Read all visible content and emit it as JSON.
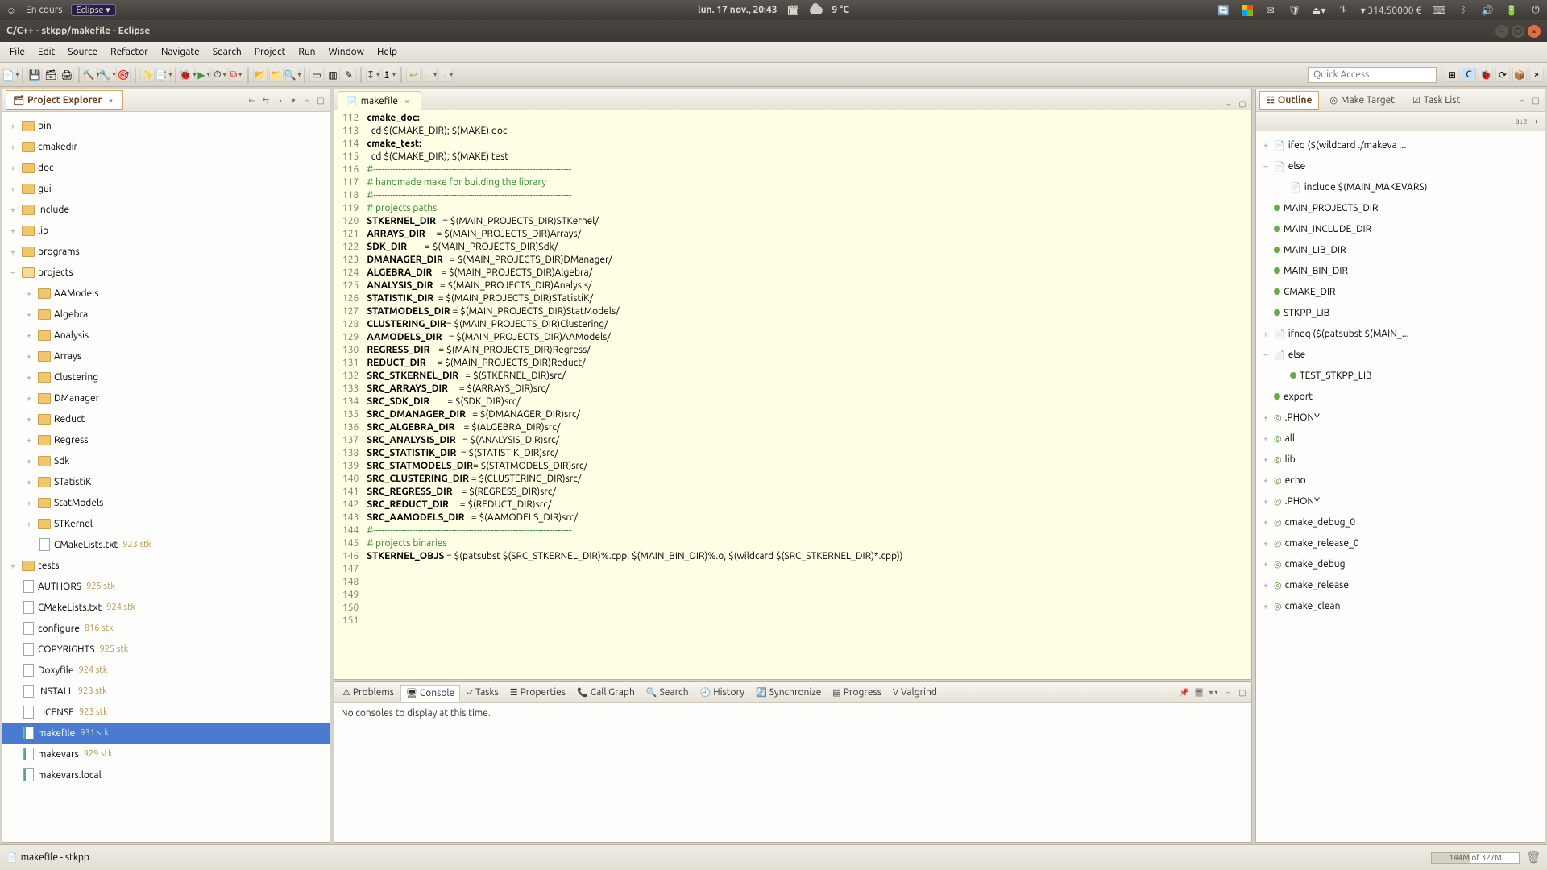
{
  "panel": {
    "activities": "En cours",
    "app": "Eclipse ▾",
    "datetime": "lun. 17 nov., 20:43",
    "temp": "9 °C",
    "balance": "314.50000 €"
  },
  "window": {
    "title": "C/C++ - stkpp/makefile - Eclipse"
  },
  "menu": [
    "File",
    "Edit",
    "Source",
    "Refactor",
    "Navigate",
    "Search",
    "Project",
    "Run",
    "Window",
    "Help"
  ],
  "quick_access_placeholder": "Quick Access",
  "explorer": {
    "title": "Project Explorer",
    "tree": [
      {
        "d": 1,
        "t": "folder",
        "exp": "+",
        "label": "bin"
      },
      {
        "d": 1,
        "t": "folder",
        "exp": "+",
        "label": "cmakedir"
      },
      {
        "d": 1,
        "t": "folder",
        "exp": "+",
        "label": "doc"
      },
      {
        "d": 1,
        "t": "folder",
        "exp": "+",
        "label": "gui"
      },
      {
        "d": 1,
        "t": "folder",
        "exp": "+",
        "label": "include"
      },
      {
        "d": 1,
        "t": "folder",
        "exp": "+",
        "label": "lib"
      },
      {
        "d": 1,
        "t": "folder",
        "exp": "+",
        "label": "programs"
      },
      {
        "d": 1,
        "t": "folder-open",
        "exp": "–",
        "label": "projects"
      },
      {
        "d": 2,
        "t": "folder",
        "exp": "+",
        "label": "AAModels"
      },
      {
        "d": 2,
        "t": "folder",
        "exp": "+",
        "label": "Algebra"
      },
      {
        "d": 2,
        "t": "folder",
        "exp": "+",
        "label": "Analysis"
      },
      {
        "d": 2,
        "t": "folder",
        "exp": "+",
        "label": "Arrays"
      },
      {
        "d": 2,
        "t": "folder",
        "exp": "+",
        "label": "Clustering"
      },
      {
        "d": 2,
        "t": "folder",
        "exp": "+",
        "label": "DManager"
      },
      {
        "d": 2,
        "t": "folder",
        "exp": "+",
        "label": "Reduct"
      },
      {
        "d": 2,
        "t": "folder",
        "exp": "+",
        "label": "Regress"
      },
      {
        "d": 2,
        "t": "folder",
        "exp": "+",
        "label": "Sdk"
      },
      {
        "d": 2,
        "t": "folder",
        "exp": "+",
        "label": "STatistiK"
      },
      {
        "d": 2,
        "t": "folder",
        "exp": "+",
        "label": "StatModels"
      },
      {
        "d": 2,
        "t": "folder",
        "exp": "+",
        "label": "STKernel"
      },
      {
        "d": 2,
        "t": "file",
        "exp": "",
        "label": "CMakeLists.txt",
        "rev": "923  stk"
      },
      {
        "d": 1,
        "t": "folder",
        "exp": "+",
        "label": "tests"
      },
      {
        "d": 1,
        "t": "file",
        "exp": "",
        "label": "AUTHORS",
        "rev": "925  stk"
      },
      {
        "d": 1,
        "t": "file",
        "exp": "",
        "label": "CMakeLists.txt",
        "rev": "924  stk"
      },
      {
        "d": 1,
        "t": "file",
        "exp": "",
        "label": "configure",
        "rev": "816  stk"
      },
      {
        "d": 1,
        "t": "file",
        "exp": "",
        "label": "COPYRIGHTS",
        "rev": "925  stk"
      },
      {
        "d": 1,
        "t": "file",
        "exp": "",
        "label": "Doxyfile",
        "rev": "924  stk"
      },
      {
        "d": 1,
        "t": "file",
        "exp": "",
        "label": "INSTALL",
        "rev": "923  stk"
      },
      {
        "d": 1,
        "t": "file",
        "exp": "",
        "label": "LICENSE",
        "rev": "923  stk"
      },
      {
        "d": 1,
        "t": "mk",
        "exp": "",
        "label": "makefile",
        "rev": "931  stk",
        "selected": true
      },
      {
        "d": 1,
        "t": "mk",
        "exp": "",
        "label": "makevars",
        "rev": "929  stk"
      },
      {
        "d": 1,
        "t": "mk",
        "exp": "",
        "label": "makevars.local"
      }
    ]
  },
  "editor": {
    "tab": "makefile",
    "first_line": 112,
    "lines": [
      {
        "cls": "",
        "txt": ""
      },
      {
        "cls": "",
        "txt": "cmake_doc:",
        "b": [
          0,
          10
        ]
      },
      {
        "cls": "",
        "txt": "  cd $(CMAKE_DIR); $(MAKE) doc"
      },
      {
        "cls": "",
        "txt": ""
      },
      {
        "cls": "",
        "txt": "cmake_test:",
        "b": [
          0,
          11
        ]
      },
      {
        "cls": "",
        "txt": "  cd $(CMAKE_DIR); $(MAKE) test"
      },
      {
        "cls": "",
        "txt": ""
      },
      {
        "cls": "comment",
        "txt": "#-----------------------------------------------------------------------"
      },
      {
        "cls": "comment",
        "txt": "# handmade make for building the library"
      },
      {
        "cls": "comment",
        "txt": "#-----------------------------------------------------------------------"
      },
      {
        "cls": "comment",
        "txt": "# projects paths"
      },
      {
        "cls": "",
        "txt": "STKERNEL_DIR   = $(MAIN_PROJECTS_DIR)STKernel/",
        "b": [
          0,
          12
        ]
      },
      {
        "cls": "",
        "txt": "ARRAYS_DIR     = $(MAIN_PROJECTS_DIR)Arrays/",
        "b": [
          0,
          10
        ]
      },
      {
        "cls": "",
        "txt": "SDK_DIR        = $(MAIN_PROJECTS_DIR)Sdk/",
        "b": [
          0,
          7
        ]
      },
      {
        "cls": "",
        "txt": "DMANAGER_DIR   = $(MAIN_PROJECTS_DIR)DManager/",
        "b": [
          0,
          12
        ]
      },
      {
        "cls": "",
        "txt": "ALGEBRA_DIR    = $(MAIN_PROJECTS_DIR)Algebra/",
        "b": [
          0,
          11
        ]
      },
      {
        "cls": "",
        "txt": "ANALYSIS_DIR   = $(MAIN_PROJECTS_DIR)Analysis/",
        "b": [
          0,
          12
        ]
      },
      {
        "cls": "",
        "txt": "STATISTIK_DIR  = $(MAIN_PROJECTS_DIR)STatistiK/",
        "b": [
          0,
          13
        ]
      },
      {
        "cls": "",
        "txt": "STATMODELS_DIR = $(MAIN_PROJECTS_DIR)StatModels/",
        "b": [
          0,
          14
        ]
      },
      {
        "cls": "",
        "txt": "CLUSTERING_DIR= $(MAIN_PROJECTS_DIR)Clustering/",
        "b": [
          0,
          14
        ]
      },
      {
        "cls": "",
        "txt": "AAMODELS_DIR   = $(MAIN_PROJECTS_DIR)AAModels/",
        "b": [
          0,
          12
        ]
      },
      {
        "cls": "",
        "txt": "REGRESS_DIR    = $(MAIN_PROJECTS_DIR)Regress/",
        "b": [
          0,
          11
        ]
      },
      {
        "cls": "",
        "txt": "REDUCT_DIR     = $(MAIN_PROJECTS_DIR)Reduct/",
        "b": [
          0,
          10
        ]
      },
      {
        "cls": "",
        "txt": ""
      },
      {
        "cls": "",
        "txt": "SRC_STKERNEL_DIR   = $(STKERNEL_DIR)src/",
        "b": [
          0,
          16
        ]
      },
      {
        "cls": "",
        "txt": "SRC_ARRAYS_DIR     = $(ARRAYS_DIR)src/",
        "b": [
          0,
          14
        ]
      },
      {
        "cls": "",
        "txt": "SRC_SDK_DIR        = $(SDK_DIR)src/",
        "b": [
          0,
          11
        ]
      },
      {
        "cls": "",
        "txt": "SRC_DMANAGER_DIR   = $(DMANAGER_DIR)src/",
        "b": [
          0,
          16
        ]
      },
      {
        "cls": "",
        "txt": "SRC_ALGEBRA_DIR    = $(ALGEBRA_DIR)src/",
        "b": [
          0,
          15
        ]
      },
      {
        "cls": "",
        "txt": "SRC_ANALYSIS_DIR   = $(ANALYSIS_DIR)src/",
        "b": [
          0,
          16
        ]
      },
      {
        "cls": "",
        "txt": "SRC_STATISTIK_DIR  = $(STATISTIK_DIR)src/",
        "b": [
          0,
          17
        ]
      },
      {
        "cls": "",
        "txt": "SRC_STATMODELS_DIR= $(STATMODELS_DIR)src/",
        "b": [
          0,
          18
        ]
      },
      {
        "cls": "",
        "txt": "SRC_CLUSTERING_DIR = $(CLUSTERING_DIR)src/",
        "b": [
          0,
          18
        ]
      },
      {
        "cls": "",
        "txt": "SRC_REGRESS_DIR    = $(REGRESS_DIR)src/",
        "b": [
          0,
          15
        ]
      },
      {
        "cls": "",
        "txt": "SRC_REDUCT_DIR     = $(REDUCT_DIR)src/",
        "b": [
          0,
          14
        ]
      },
      {
        "cls": "",
        "txt": "SRC_AAMODELS_DIR   = $(AAMODELS_DIR)src/",
        "b": [
          0,
          16
        ]
      },
      {
        "cls": "",
        "txt": ""
      },
      {
        "cls": "comment",
        "txt": "#-----------------------------------------------------------------------"
      },
      {
        "cls": "comment",
        "txt": "# projects binaries"
      },
      {
        "cls": "",
        "txt": "STKERNEL_OBJS = $(patsubst $(SRC_STKERNEL_DIR)%.cpp, $(MAIN_BIN_DIR)%.o, $(wildcard $(SRC_STKERNEL_DIR)*.cpp))",
        "b": [
          0,
          13
        ]
      }
    ]
  },
  "bottom": {
    "tabs": [
      "Problems",
      "Console",
      "Tasks",
      "Properties",
      "Call Graph",
      "Search",
      "History",
      "Synchronize",
      "Progress",
      "Valgrind"
    ],
    "active": 1,
    "console_msg": "No consoles to display at this time."
  },
  "outline": {
    "tabs": [
      "Outline",
      "Make Target",
      "Task List"
    ],
    "items": [
      {
        "tw": "+",
        "sub": false,
        "k": "inc",
        "label": "ifeq ($(wildcard ./makeva ..."
      },
      {
        "tw": "–",
        "sub": false,
        "k": "inc",
        "label": "else"
      },
      {
        "tw": "",
        "sub": true,
        "k": "inc",
        "label": "include $(MAIN_MAKEVARS)"
      },
      {
        "tw": "",
        "sub": false,
        "k": "dot",
        "label": "MAIN_PROJECTS_DIR"
      },
      {
        "tw": "",
        "sub": false,
        "k": "dot",
        "label": "MAIN_INCLUDE_DIR"
      },
      {
        "tw": "",
        "sub": false,
        "k": "dot",
        "label": "MAIN_LIB_DIR"
      },
      {
        "tw": "",
        "sub": false,
        "k": "dot",
        "label": "MAIN_BIN_DIR"
      },
      {
        "tw": "",
        "sub": false,
        "k": "dot",
        "label": "CMAKE_DIR"
      },
      {
        "tw": "",
        "sub": false,
        "k": "dot",
        "label": "STKPP_LIB"
      },
      {
        "tw": "+",
        "sub": false,
        "k": "inc",
        "label": "ifneq ($(patsubst $(MAIN_..."
      },
      {
        "tw": "–",
        "sub": false,
        "k": "inc",
        "label": "else"
      },
      {
        "tw": "",
        "sub": true,
        "k": "dot",
        "label": "TEST_STKPP_LIB"
      },
      {
        "tw": "",
        "sub": false,
        "k": "dot",
        "label": "export"
      },
      {
        "tw": "+",
        "sub": false,
        "k": "tgt",
        "label": ".PHONY"
      },
      {
        "tw": "+",
        "sub": false,
        "k": "tgt",
        "label": "all"
      },
      {
        "tw": "+",
        "sub": false,
        "k": "tgt",
        "label": "lib"
      },
      {
        "tw": "+",
        "sub": false,
        "k": "tgt",
        "label": "echo"
      },
      {
        "tw": "+",
        "sub": false,
        "k": "tgt",
        "label": ".PHONY"
      },
      {
        "tw": "+",
        "sub": false,
        "k": "tgt",
        "label": "cmake_debug_0"
      },
      {
        "tw": "+",
        "sub": false,
        "k": "tgt",
        "label": "cmake_release_0"
      },
      {
        "tw": "+",
        "sub": false,
        "k": "tgt",
        "label": "cmake_debug"
      },
      {
        "tw": "+",
        "sub": false,
        "k": "tgt",
        "label": "cmake_release"
      },
      {
        "tw": "+",
        "sub": false,
        "k": "tgt",
        "label": "cmake_clean"
      }
    ]
  },
  "status": {
    "path": "makefile - stkpp",
    "heap": "144M of 327M"
  }
}
